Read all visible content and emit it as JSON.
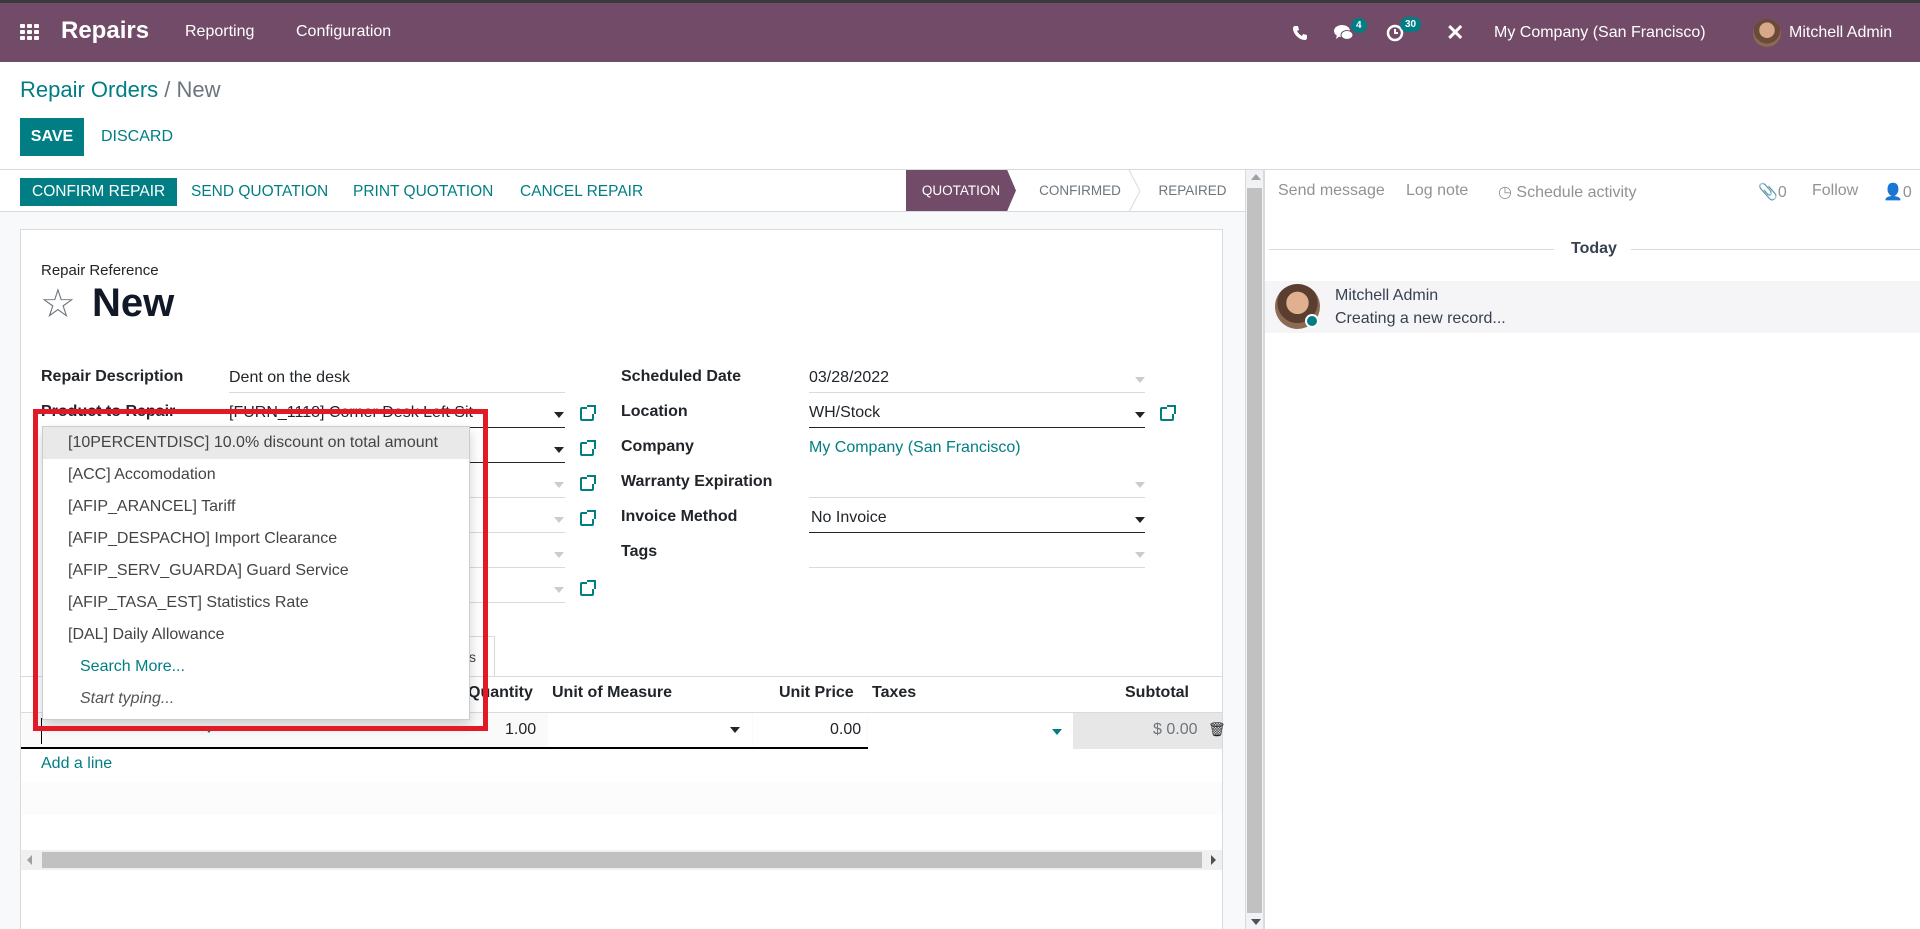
{
  "navbar": {
    "app_name": "Repairs",
    "menu": [
      "Reporting",
      "Configuration"
    ],
    "messages_count": "4",
    "activities_count": "30",
    "company": "My Company (San Francisco)",
    "user": "Mitchell Admin",
    "icons": {
      "apps": "apps-grid-icon",
      "phone": "phone-icon",
      "chat": "chat-icon",
      "activity": "clock-icon",
      "debug": "tools-icon"
    }
  },
  "breadcrumb": {
    "parent": "Repair Orders",
    "separator": "/",
    "current": "New"
  },
  "actions": {
    "save": "SAVE",
    "discard": "DISCARD"
  },
  "header_buttons": [
    "CONFIRM REPAIR",
    "SEND QUOTATION",
    "PRINT QUOTATION",
    "CANCEL REPAIR"
  ],
  "stages": [
    {
      "label": "QUOTATION",
      "active": true
    },
    {
      "label": "CONFIRMED",
      "active": false
    },
    {
      "label": "REPAIRED",
      "active": false
    }
  ],
  "form": {
    "reference_label": "Repair Reference",
    "reference_value": "New",
    "left_fields": [
      {
        "label": "Repair Description",
        "value": "Dent on the desk"
      },
      {
        "label": "Product to Repair",
        "value": "[FURN_1118] Corner Desk Left Sit"
      }
    ],
    "right_fields": [
      {
        "label": "Scheduled Date",
        "value": "03/28/2022"
      },
      {
        "label": "Location",
        "value": "WH/Stock"
      },
      {
        "label": "Company",
        "value": "My Company (San Francisco)"
      },
      {
        "label": "Warranty Expiration",
        "value": ""
      },
      {
        "label": "Invoice Method",
        "value": "No Invoice"
      },
      {
        "label": "Tags",
        "value": ""
      }
    ],
    "tab_partial": "s"
  },
  "dropdown": {
    "items": [
      "[10PERCENTDISC] 10.0% discount on total amount",
      "[ACC] Accomodation",
      "[AFIP_ARANCEL] Tariff",
      "[AFIP_DESPACHO] Import Clearance",
      "[AFIP_SERV_GUARDA] Guard Service",
      "[AFIP_TASA_EST] Statistics Rate",
      "[DAL] Daily Allowance"
    ],
    "search_more": "Search More...",
    "start_typing": "Start typing..."
  },
  "table": {
    "headers": [
      "Quantity",
      "Unit of Measure",
      "Unit Price",
      "Taxes",
      "Subtotal"
    ],
    "row": {
      "quantity": "1.00",
      "uom": "",
      "unit_price": "0.00",
      "taxes": "",
      "subtotal": "$ 0.00"
    },
    "add_line": "Add a line"
  },
  "chatter": {
    "send_message": "Send message",
    "log_note": "Log note",
    "schedule_activity": "Schedule activity",
    "attachments": "0",
    "follow": "Follow",
    "followers": "0",
    "date_separator": "Today",
    "message": {
      "author": "Mitchell Admin",
      "body": "Creating a new record..."
    }
  },
  "colors": {
    "brand": "#714b67",
    "accent": "#017e84",
    "highlight": "#e21a25"
  }
}
